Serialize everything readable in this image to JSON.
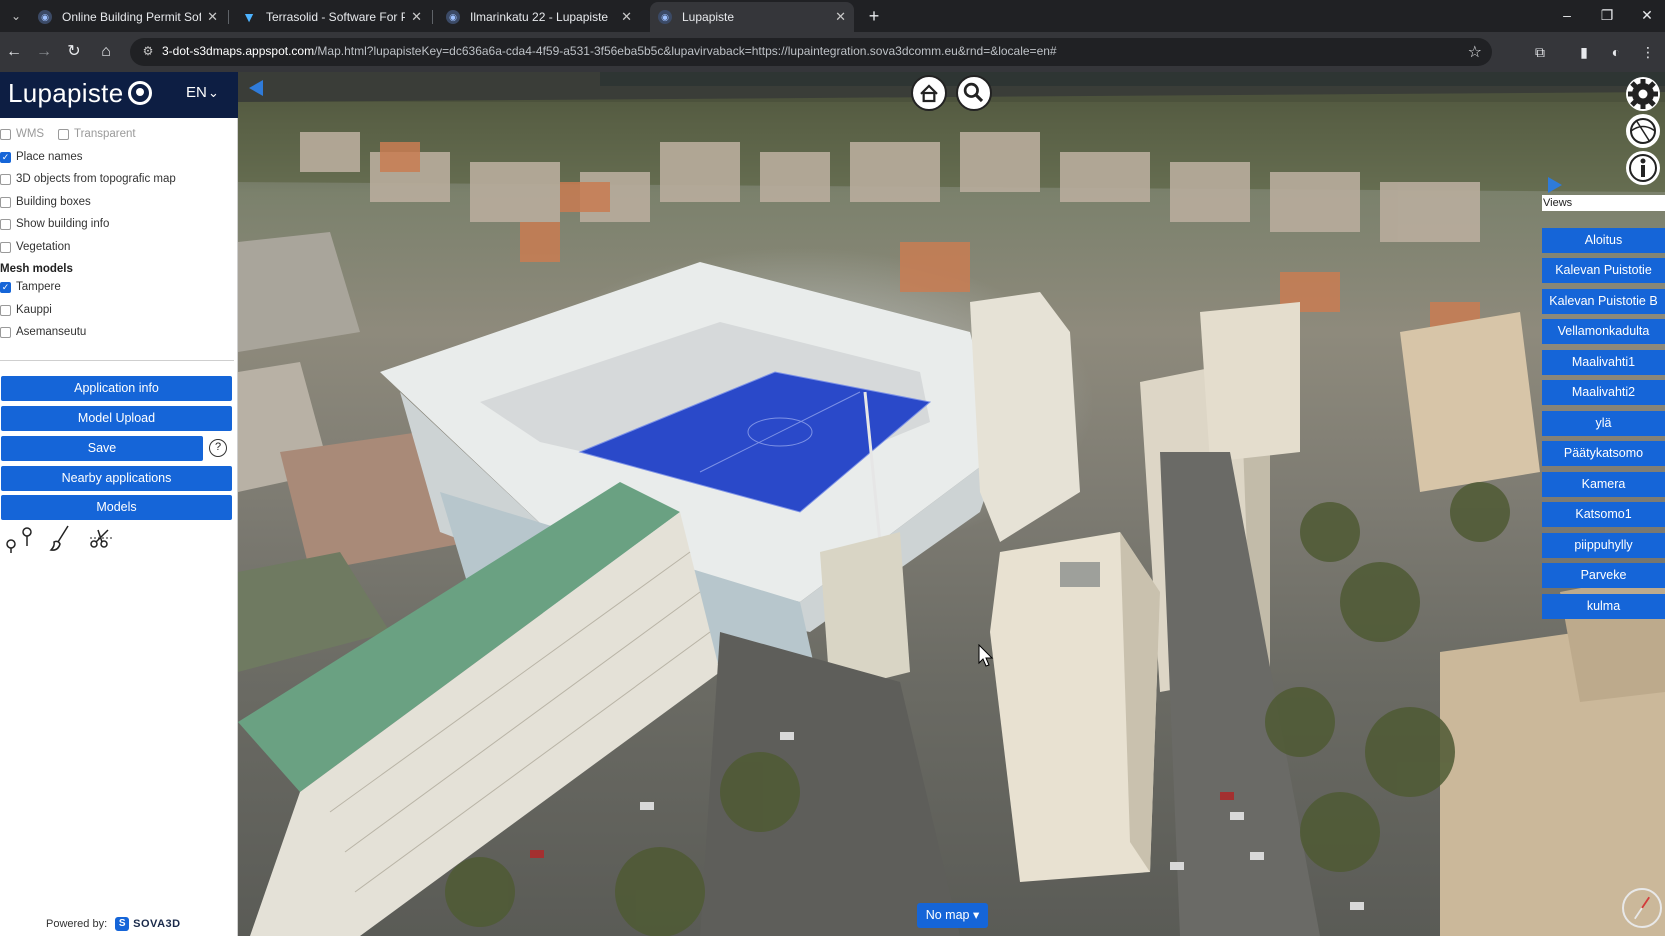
{
  "browser": {
    "tabs": [
      {
        "title": "Online Building Permit Software",
        "active": false
      },
      {
        "title": "Terrasolid - Software For Point Cloud",
        "active": false
      },
      {
        "title": "Ilmarinkatu 22 - Lupapiste",
        "active": false
      },
      {
        "title": "Lupapiste",
        "active": true
      }
    ],
    "new_tab_label": "+",
    "url_host": "3-dot-s3dmaps.appspot.com",
    "url_rest": "/Map.html?lupapisteKey=dc636a6a-cda4-4f59-a531-3f56eba5b5c&lupavirvaback=https://lupaintegration.sova3dcomm.eu&rnd=&locale=en#"
  },
  "panel": {
    "logo": "Lupapiste",
    "language": "EN",
    "layers": [
      {
        "label": "WMS",
        "checked": false,
        "disabled": true
      },
      {
        "label": "Transparent",
        "checked": false,
        "disabled": true
      },
      {
        "label": "Place names",
        "checked": true
      },
      {
        "label": "3D objects from topografic map",
        "checked": false
      },
      {
        "label": "Building boxes",
        "checked": false
      },
      {
        "label": "Show building info",
        "checked": false
      },
      {
        "label": "Vegetation",
        "checked": false
      }
    ],
    "mesh_title": "Mesh models",
    "mesh_models": [
      {
        "label": "Tampere",
        "checked": true
      },
      {
        "label": "Kauppi",
        "checked": false
      },
      {
        "label": "Asemanseutu",
        "checked": false
      }
    ],
    "buttons": {
      "application_info": "Application info",
      "model_upload": "Model Upload",
      "save": "Save",
      "help": "?",
      "nearby": "Nearby applications",
      "models": "Models"
    },
    "powered_by": "Powered by:",
    "sova_brand": "SOVA3D"
  },
  "map": {
    "views_label": "Views",
    "views": [
      "Aloitus",
      "Kalevan Puistotie",
      "Kalevan Puistotie B",
      "Vellamonkadulta",
      "Maalivahti1",
      "Maalivahti2",
      "ylä",
      "Päätykatsomo",
      "Kamera",
      "Katsomo1",
      "piippuhylly",
      "Parveke",
      "kulma"
    ],
    "no_map": "No map ▾"
  },
  "colors": {
    "accent": "#1565d8",
    "logo_bar": "#0d1e43",
    "pitch": "#2a49c9"
  }
}
